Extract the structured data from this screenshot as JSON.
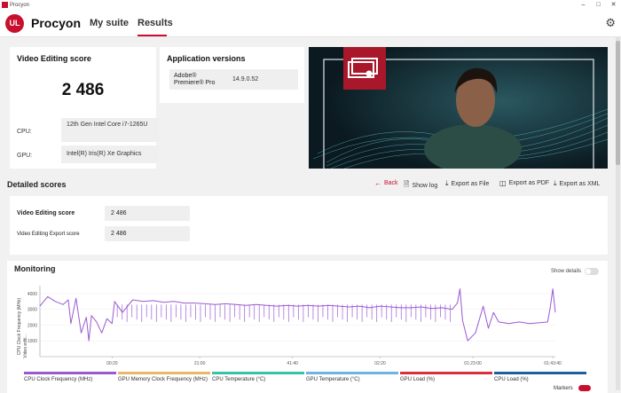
{
  "window": {
    "title": "Procyon"
  },
  "header": {
    "logo": "UL",
    "brand": "Procyon",
    "nav": [
      {
        "label": "My suite"
      },
      {
        "label": "Results"
      }
    ]
  },
  "score_card": {
    "title": "Video Editing score",
    "value": "2 486",
    "cpu_label": "CPU:",
    "cpu_value": "12th Gen Intel Core i7-1265U",
    "gpu_label": "GPU:",
    "gpu_value": "Intel(R) Iris(R) Xe Graphics"
  },
  "app_versions": {
    "title": "Application versions",
    "app_name": "Adobe® Premiere® Pro",
    "app_version": "14.9.0.52"
  },
  "detailed": {
    "title": "Detailed scores",
    "actions": {
      "back": "Back",
      "show_log": "Show log",
      "export_file": "Export as File",
      "export_pdf": "Export as PDF",
      "export_xml": "Export as XML"
    },
    "rows": [
      {
        "label": "Video Editing score",
        "value": "2 486"
      },
      {
        "label": "Video Editing Export score",
        "value": "2 486"
      }
    ]
  },
  "monitoring": {
    "title": "Monitoring",
    "show_details": "Show details",
    "markers": "Markers",
    "legend": [
      {
        "label": "CPU Clock Frequency (MHz)",
        "color": "#9b59d0"
      },
      {
        "label": "GPU Memory Clock Frequency (MHz)",
        "color": "#e8b86a"
      },
      {
        "label": "CPU Temperature (°C)",
        "color": "#37c3a8"
      },
      {
        "label": "GPU Temperature (°C)",
        "color": "#6fb3e0"
      },
      {
        "label": "GPU Load (%)",
        "color": "#d9303a"
      },
      {
        "label": "CPU Load (%)",
        "color": "#1d5fa0"
      }
    ]
  },
  "chart_data": {
    "type": "line",
    "ylabel": "CPU Clock Frequency (MHz)",
    "ylabel2": "Video editi...",
    "yticks": [
      "4000",
      "3000",
      "2000",
      "1000"
    ],
    "xticks": [
      "00:20",
      "21:00",
      "41:40",
      "02:20",
      "01:23:00",
      "01:43:40"
    ],
    "ylim": [
      0,
      4500
    ],
    "series": [
      {
        "name": "CPU Clock Frequency (MHz)",
        "color": "#9b59d0",
        "points": [
          [
            0.0,
            3200
          ],
          [
            0.015,
            3800
          ],
          [
            0.03,
            3500
          ],
          [
            0.045,
            3300
          ],
          [
            0.055,
            3600
          ],
          [
            0.06,
            2100
          ],
          [
            0.07,
            3700
          ],
          [
            0.08,
            1500
          ],
          [
            0.09,
            2500
          ],
          [
            0.095,
            1000
          ],
          [
            0.1,
            2600
          ],
          [
            0.11,
            2200
          ],
          [
            0.12,
            1500
          ],
          [
            0.13,
            2400
          ],
          [
            0.14,
            2100
          ],
          [
            0.145,
            3500
          ],
          [
            0.16,
            2800
          ],
          [
            0.18,
            3600
          ],
          [
            0.2,
            3500
          ],
          [
            0.22,
            3550
          ],
          [
            0.24,
            3450
          ],
          [
            0.26,
            3500
          ],
          [
            0.28,
            3400
          ],
          [
            0.3,
            3400
          ],
          [
            0.32,
            3350
          ],
          [
            0.34,
            3300
          ],
          [
            0.36,
            3350
          ],
          [
            0.38,
            3300
          ],
          [
            0.4,
            3250
          ],
          [
            0.42,
            3300
          ],
          [
            0.44,
            3250
          ],
          [
            0.46,
            3200
          ],
          [
            0.48,
            3250
          ],
          [
            0.5,
            3200
          ],
          [
            0.52,
            3250
          ],
          [
            0.54,
            3200
          ],
          [
            0.56,
            3250
          ],
          [
            0.58,
            3200
          ],
          [
            0.6,
            3150
          ],
          [
            0.62,
            3200
          ],
          [
            0.64,
            3100
          ],
          [
            0.66,
            3200
          ],
          [
            0.68,
            3150
          ],
          [
            0.7,
            3100
          ],
          [
            0.72,
            3100
          ],
          [
            0.74,
            3150
          ],
          [
            0.76,
            3050
          ],
          [
            0.78,
            3100
          ],
          [
            0.8,
            3000
          ],
          [
            0.81,
            3400
          ],
          [
            0.815,
            4300
          ],
          [
            0.82,
            2300
          ],
          [
            0.83,
            1000
          ],
          [
            0.845,
            1500
          ],
          [
            0.86,
            3200
          ],
          [
            0.87,
            1800
          ],
          [
            0.88,
            2800
          ],
          [
            0.89,
            2200
          ],
          [
            0.91,
            2100
          ],
          [
            0.93,
            2200
          ],
          [
            0.95,
            2100
          ],
          [
            0.97,
            2150
          ],
          [
            0.985,
            2200
          ],
          [
            0.99,
            3100
          ],
          [
            0.995,
            4300
          ],
          [
            1.0,
            2800
          ]
        ]
      }
    ]
  }
}
